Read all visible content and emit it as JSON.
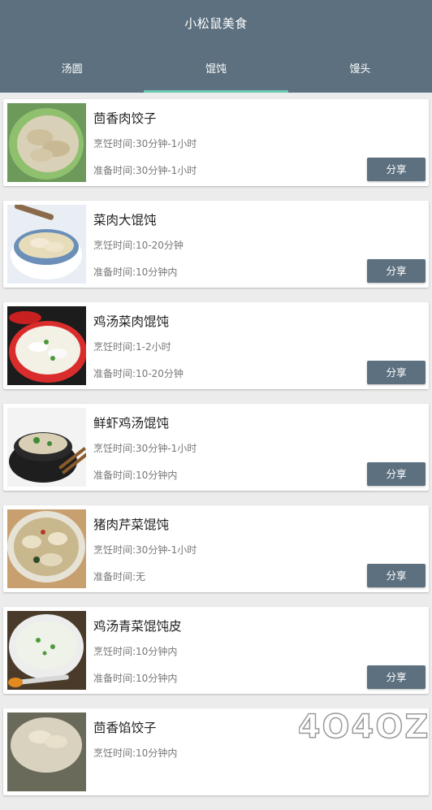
{
  "app": {
    "title": "小松鼠美食"
  },
  "tabs": [
    {
      "label": "汤圆",
      "active": false
    },
    {
      "label": "馄饨",
      "active": true
    },
    {
      "label": "馒头",
      "active": false
    }
  ],
  "colors": {
    "primary": "#5d707f",
    "tab_indicator": "#69c8b0",
    "background": "#ececec"
  },
  "share_label": "分享",
  "recipes": [
    {
      "name": "茴香肉饺子",
      "cook": "烹饪时间:30分钟-1小时",
      "prep": "准备时间:30分钟-1小时"
    },
    {
      "name": "菜肉大馄饨",
      "cook": "烹饪时间:10-20分钟",
      "prep": "准备时间:10分钟内"
    },
    {
      "name": "鸡汤菜肉馄饨",
      "cook": "烹饪时间:1-2小时",
      "prep": "准备时间:10-20分钟"
    },
    {
      "name": "鲜虾鸡汤馄饨",
      "cook": "烹饪时间:30分钟-1小时",
      "prep": "准备时间:10分钟内"
    },
    {
      "name": "猪肉芹菜馄饨",
      "cook": "烹饪时间:30分钟-1小时",
      "prep": "准备时间:无"
    },
    {
      "name": "鸡汤青菜馄饨皮",
      "cook": "烹饪时间:10分钟内",
      "prep": "准备时间:10分钟内"
    },
    {
      "name": "茴香馅饺子",
      "cook": "烹饪时间:10分钟内",
      "prep": ""
    }
  ],
  "watermark": "4O4OZ"
}
